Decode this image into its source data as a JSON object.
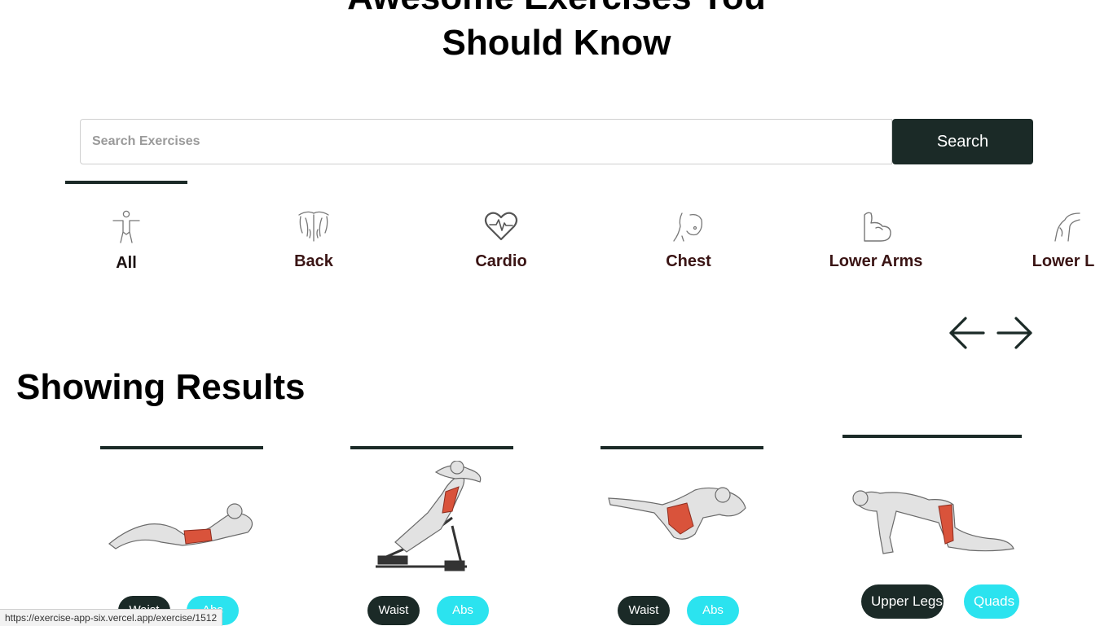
{
  "hero": {
    "title_line1": "Awesome Exercises You",
    "title_line2": "Should Know"
  },
  "search": {
    "placeholder": "Search Exercises",
    "value": "",
    "button_label": "Search"
  },
  "categories": [
    {
      "label": "All",
      "icon": "person-icon",
      "active": true
    },
    {
      "label": "Back",
      "icon": "back-muscle-icon",
      "active": false
    },
    {
      "label": "Cardio",
      "icon": "heart-pulse-icon",
      "active": false
    },
    {
      "label": "Chest",
      "icon": "chest-icon",
      "active": false
    },
    {
      "label": "Lower Arms",
      "icon": "arm-icon",
      "active": false
    },
    {
      "label": "Lower L",
      "icon": "leg-icon",
      "active": false
    }
  ],
  "nav": {
    "prev_icon": "arrow-left-icon",
    "next_icon": "arrow-right-icon"
  },
  "results": {
    "title": "Showing Results",
    "cards": [
      {
        "image": "crunch-illustration",
        "tags": [
          "Waist",
          "Abs"
        ]
      },
      {
        "image": "incline-situp-illustration",
        "tags": [
          "Waist",
          "Abs"
        ]
      },
      {
        "image": "v-crunch-illustration",
        "tags": [
          "Waist",
          "Abs"
        ]
      },
      {
        "image": "kneeling-illustration",
        "tags": [
          "Upper Legs",
          "Quads"
        ]
      }
    ]
  },
  "status_bar": {
    "url": "https://exercise-app-six.vercel.app/exercise/1512"
  },
  "colors": {
    "accent_dark": "#1b2a27",
    "accent_cyan": "#2be3ef",
    "label_dark": "#3a1414"
  }
}
